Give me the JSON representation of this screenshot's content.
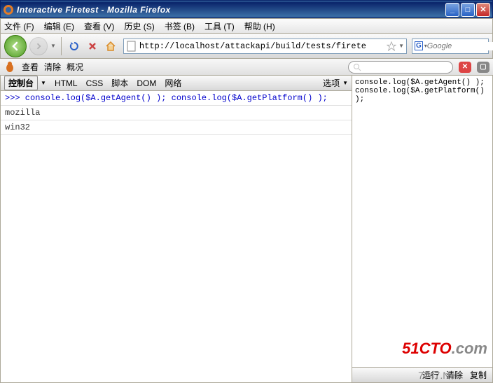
{
  "window": {
    "title": "Interactive Firetest - Mozilla Firefox"
  },
  "menu": {
    "file": "文件 (F)",
    "edit": "编辑 (E)",
    "view": "查看 (V)",
    "history": "历史 (S)",
    "bookmarks": "书签 (B)",
    "tools": "工具 (T)",
    "help": "帮助 (H)"
  },
  "url": "http://localhost/attackapi/build/tests/firete",
  "search_placeholder": "Google",
  "firebug": {
    "inspect": "查看",
    "clear": "清除",
    "profile": "概况"
  },
  "tabs": {
    "console": "控制台",
    "html": "HTML",
    "css": "CSS",
    "script": "脚本",
    "dom": "DOM",
    "net": "网络",
    "options": "选项"
  },
  "console_input": ">>> console.log($A.getAgent() ); console.log($A.getPlatform() );",
  "console_out1": "mozilla",
  "console_out2": "win32",
  "side_code": "console.log($A.getAgent() );\nconsole.log($A.getPlatform() );",
  "footer": {
    "run": "运行",
    "clear": "清除",
    "copy": "复制"
  },
  "watermark": {
    "a": "51CTO",
    "b": ".com",
    "c": "7747.Net"
  }
}
